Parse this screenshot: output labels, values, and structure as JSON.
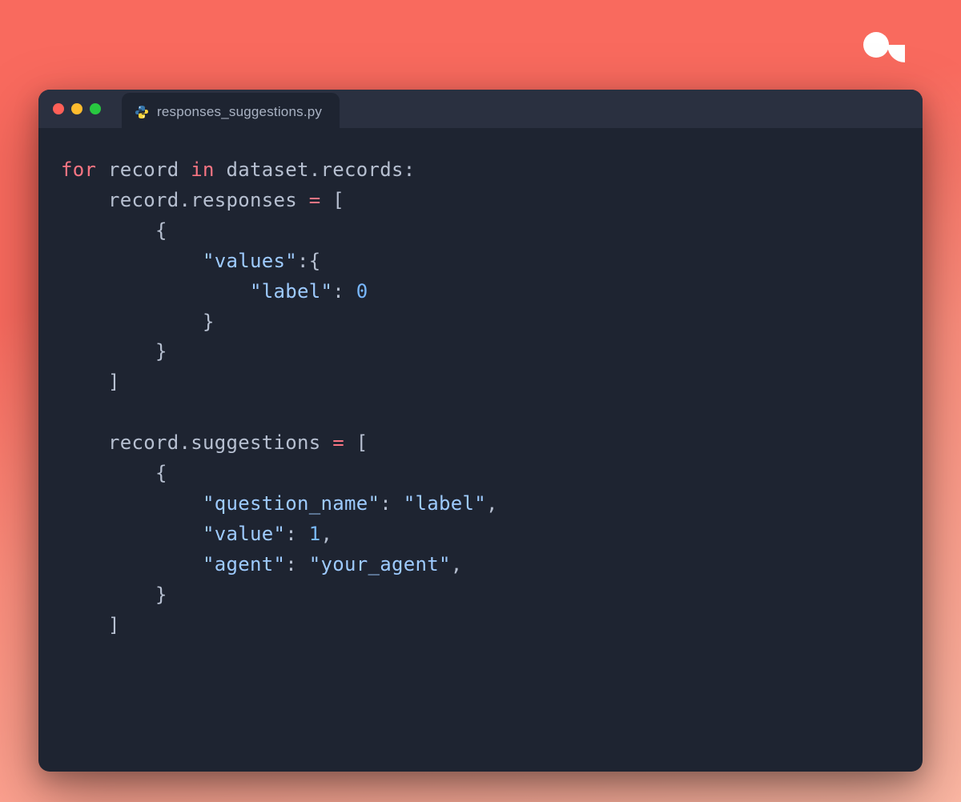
{
  "logo": {
    "name": "argilla-logo"
  },
  "window": {
    "traffic_lights": [
      "close",
      "minimize",
      "zoom"
    ]
  },
  "tab": {
    "filename": "responses_suggestions.py",
    "icon": "python-file-icon"
  },
  "code": {
    "tokens": [
      [
        {
          "t": "for",
          "c": "keyword"
        },
        {
          "t": " ",
          "c": "ident"
        },
        {
          "t": "record",
          "c": "ident"
        },
        {
          "t": " ",
          "c": "ident"
        },
        {
          "t": "in",
          "c": "keyword"
        },
        {
          "t": " ",
          "c": "ident"
        },
        {
          "t": "dataset",
          "c": "ident"
        },
        {
          "t": ".",
          "c": "punct"
        },
        {
          "t": "records",
          "c": "ident"
        },
        {
          "t": ":",
          "c": "punct"
        }
      ],
      [
        {
          "t": "    ",
          "c": "ident"
        },
        {
          "t": "record",
          "c": "ident"
        },
        {
          "t": ".",
          "c": "punct"
        },
        {
          "t": "responses",
          "c": "ident"
        },
        {
          "t": " ",
          "c": "ident"
        },
        {
          "t": "=",
          "c": "op"
        },
        {
          "t": " ",
          "c": "ident"
        },
        {
          "t": "[",
          "c": "punct"
        }
      ],
      [
        {
          "t": "        ",
          "c": "ident"
        },
        {
          "t": "{",
          "c": "punct"
        }
      ],
      [
        {
          "t": "            ",
          "c": "ident"
        },
        {
          "t": "\"values\"",
          "c": "string"
        },
        {
          "t": ":",
          "c": "punct"
        },
        {
          "t": "{",
          "c": "punct"
        }
      ],
      [
        {
          "t": "                ",
          "c": "ident"
        },
        {
          "t": "\"label\"",
          "c": "string"
        },
        {
          "t": ":",
          "c": "punct"
        },
        {
          "t": " ",
          "c": "ident"
        },
        {
          "t": "0",
          "c": "number"
        }
      ],
      [
        {
          "t": "            ",
          "c": "ident"
        },
        {
          "t": "}",
          "c": "punct"
        }
      ],
      [
        {
          "t": "        ",
          "c": "ident"
        },
        {
          "t": "}",
          "c": "punct"
        }
      ],
      [
        {
          "t": "    ",
          "c": "ident"
        },
        {
          "t": "]",
          "c": "punct"
        }
      ],
      [
        {
          "t": "",
          "c": "ident"
        }
      ],
      [
        {
          "t": "    ",
          "c": "ident"
        },
        {
          "t": "record",
          "c": "ident"
        },
        {
          "t": ".",
          "c": "punct"
        },
        {
          "t": "suggestions",
          "c": "ident"
        },
        {
          "t": " ",
          "c": "ident"
        },
        {
          "t": "=",
          "c": "op"
        },
        {
          "t": " ",
          "c": "ident"
        },
        {
          "t": "[",
          "c": "punct"
        }
      ],
      [
        {
          "t": "        ",
          "c": "ident"
        },
        {
          "t": "{",
          "c": "punct"
        }
      ],
      [
        {
          "t": "            ",
          "c": "ident"
        },
        {
          "t": "\"question_name\"",
          "c": "string"
        },
        {
          "t": ":",
          "c": "punct"
        },
        {
          "t": " ",
          "c": "ident"
        },
        {
          "t": "\"label\"",
          "c": "string"
        },
        {
          "t": ",",
          "c": "punct"
        }
      ],
      [
        {
          "t": "            ",
          "c": "ident"
        },
        {
          "t": "\"value\"",
          "c": "string"
        },
        {
          "t": ":",
          "c": "punct"
        },
        {
          "t": " ",
          "c": "ident"
        },
        {
          "t": "1",
          "c": "number"
        },
        {
          "t": ",",
          "c": "punct"
        }
      ],
      [
        {
          "t": "            ",
          "c": "ident"
        },
        {
          "t": "\"agent\"",
          "c": "string"
        },
        {
          "t": ":",
          "c": "punct"
        },
        {
          "t": " ",
          "c": "ident"
        },
        {
          "t": "\"your_agent\"",
          "c": "string"
        },
        {
          "t": ",",
          "c": "punct"
        }
      ],
      [
        {
          "t": "        ",
          "c": "ident"
        },
        {
          "t": "}",
          "c": "punct"
        }
      ],
      [
        {
          "t": "    ",
          "c": "ident"
        },
        {
          "t": "]",
          "c": "punct"
        }
      ]
    ]
  }
}
